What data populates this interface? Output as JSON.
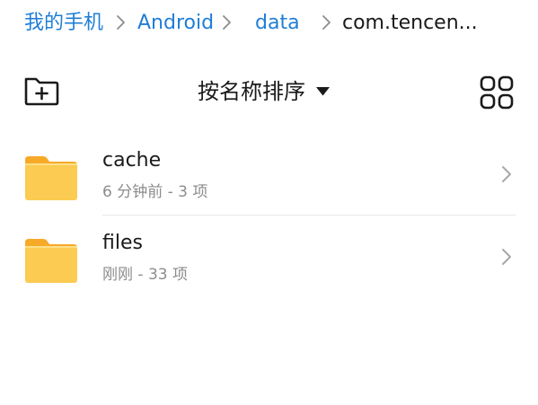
{
  "breadcrumb": {
    "items": [
      {
        "label": "我的手机"
      },
      {
        "label": "Android"
      },
      {
        "label": "data"
      },
      {
        "label": "com.tencen..."
      }
    ]
  },
  "toolbar": {
    "new_folder_icon": "folder-plus-icon",
    "sort_label": "按名称排序",
    "sort_icon": "caret-down-icon",
    "view_toggle_icon": "grid-view-icon"
  },
  "files": [
    {
      "name": "cache",
      "meta": "6 分钟前 - 3 项",
      "icon": "folder-icon"
    },
    {
      "name": "files",
      "meta": "刚刚 - 33 项",
      "icon": "folder-icon"
    }
  ],
  "colors": {
    "accent": "#1f7ed6",
    "folder": "#fccb52",
    "folder_tab": "#f7a928",
    "text_primary": "#1a1a1a",
    "text_secondary": "#8c8c8c"
  }
}
